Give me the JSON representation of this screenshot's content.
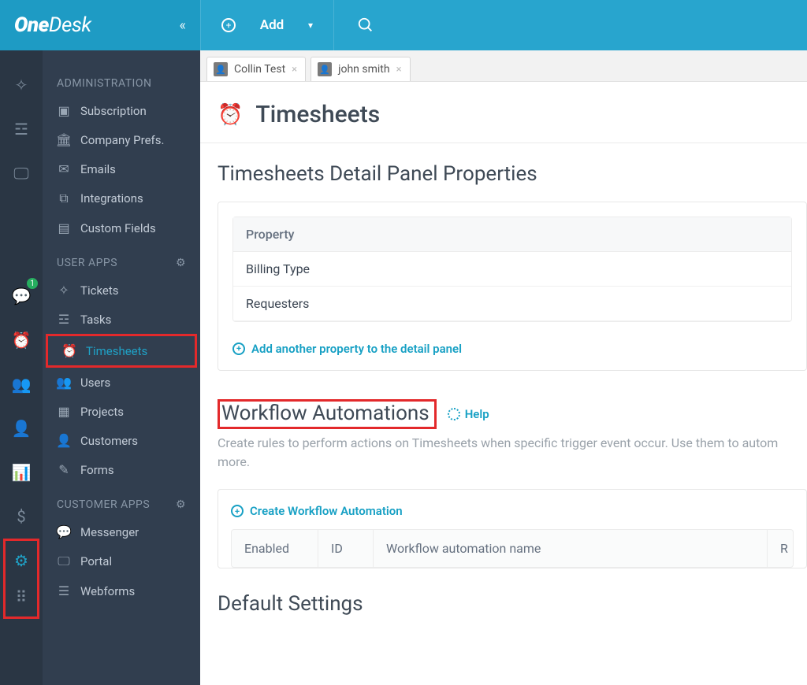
{
  "brand": {
    "name_bold": "One",
    "name_light": "Desk"
  },
  "topbar": {
    "add_label": "Add"
  },
  "rail": {
    "badge": "1"
  },
  "tabs": [
    {
      "label": "Collin Test"
    },
    {
      "label": "john smith"
    }
  ],
  "sidebar": {
    "heading_admin": "ADMINISTRATION",
    "admin_items": [
      {
        "icon": "$",
        "label": "Subscription"
      },
      {
        "icon": "🏛",
        "label": "Company Prefs."
      },
      {
        "icon": "✉",
        "label": "Emails"
      },
      {
        "icon": "⧉",
        "label": "Integrations"
      },
      {
        "icon": "▤",
        "label": "Custom Fields"
      }
    ],
    "heading_user": "USER APPS",
    "user_items": [
      {
        "icon": "✧",
        "label": "Tickets"
      },
      {
        "icon": "☲",
        "label": "Tasks"
      },
      {
        "icon": "⏰",
        "label": "Timesheets",
        "selected": true
      },
      {
        "icon": "👥",
        "label": "Users"
      },
      {
        "icon": "▦",
        "label": "Projects"
      },
      {
        "icon": "👤",
        "label": "Customers"
      },
      {
        "icon": "✎",
        "label": "Forms"
      }
    ],
    "heading_cust": "CUSTOMER APPS",
    "cust_items": [
      {
        "icon": "💬",
        "label": "Messenger"
      },
      {
        "icon": "🖵",
        "label": "Portal"
      },
      {
        "icon": "☰",
        "label": "Webforms"
      }
    ]
  },
  "page": {
    "title": "Timesheets",
    "detail_heading": "Timesheets Detail Panel Properties",
    "prop_col": "Property",
    "props": [
      "Billing Type",
      "Requesters"
    ],
    "add_prop": "Add another property to the detail panel",
    "wa_heading": "Workflow Automations",
    "help": "Help",
    "wa_desc": "Create rules to perform actions on Timesheets when specific trigger event occur. Use them to autom more.",
    "wa_create": "Create Workflow Automation",
    "wa_cols": {
      "enabled": "Enabled",
      "id": "ID",
      "name": "Workflow automation name",
      "r": "R"
    },
    "default_heading": "Default Settings"
  }
}
